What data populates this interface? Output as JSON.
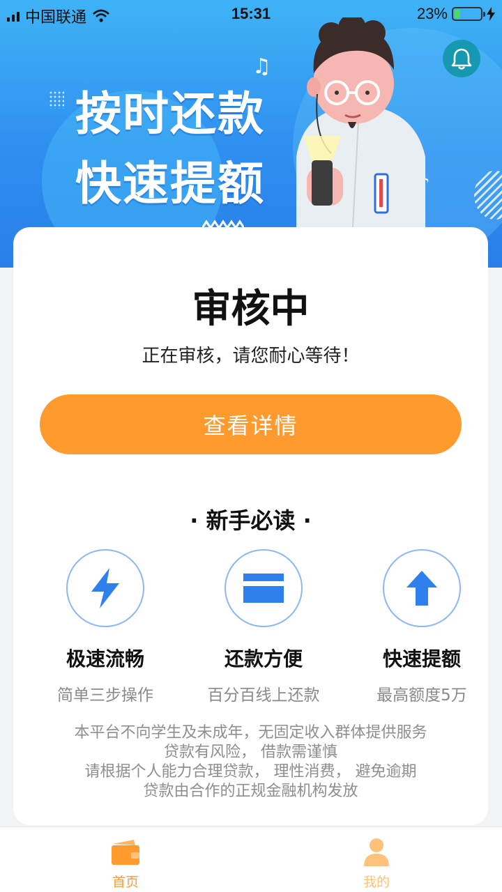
{
  "status_bar": {
    "carrier": "中国联通",
    "time": "15:31",
    "battery": "23%",
    "battery_level": 0.23
  },
  "banner": {
    "line1": "按时还款",
    "line2": "快速提额"
  },
  "review": {
    "title": "审核中",
    "subtitle": "正在审核，请您耐心等待！",
    "button": "查看详情"
  },
  "guide": {
    "title": "· 新手必读 ·",
    "features": [
      {
        "icon": "lightning-icon",
        "title": "极速流畅",
        "desc": "简单三步操作"
      },
      {
        "icon": "card-icon",
        "title": "还款方便",
        "desc": "百分百线上还款"
      },
      {
        "icon": "arrow-up-icon",
        "title": "快速提额",
        "desc": "最高额度5万"
      }
    ]
  },
  "disclaimer": [
    "本平台不向学生及未成年，无固定收入群体提供服务",
    "贷款有风险， 借款需谨慎",
    "请根据个人能力合理贷款， 理性消费， 避免逾期",
    "贷款由合作的正规金融机构发放"
  ],
  "tabbar": {
    "home": "首页",
    "mine": "我的"
  },
  "colors": {
    "accent": "#ff9a2e",
    "banner_blue": "#2f8ff0",
    "icon_blue": "#2f80ed"
  }
}
